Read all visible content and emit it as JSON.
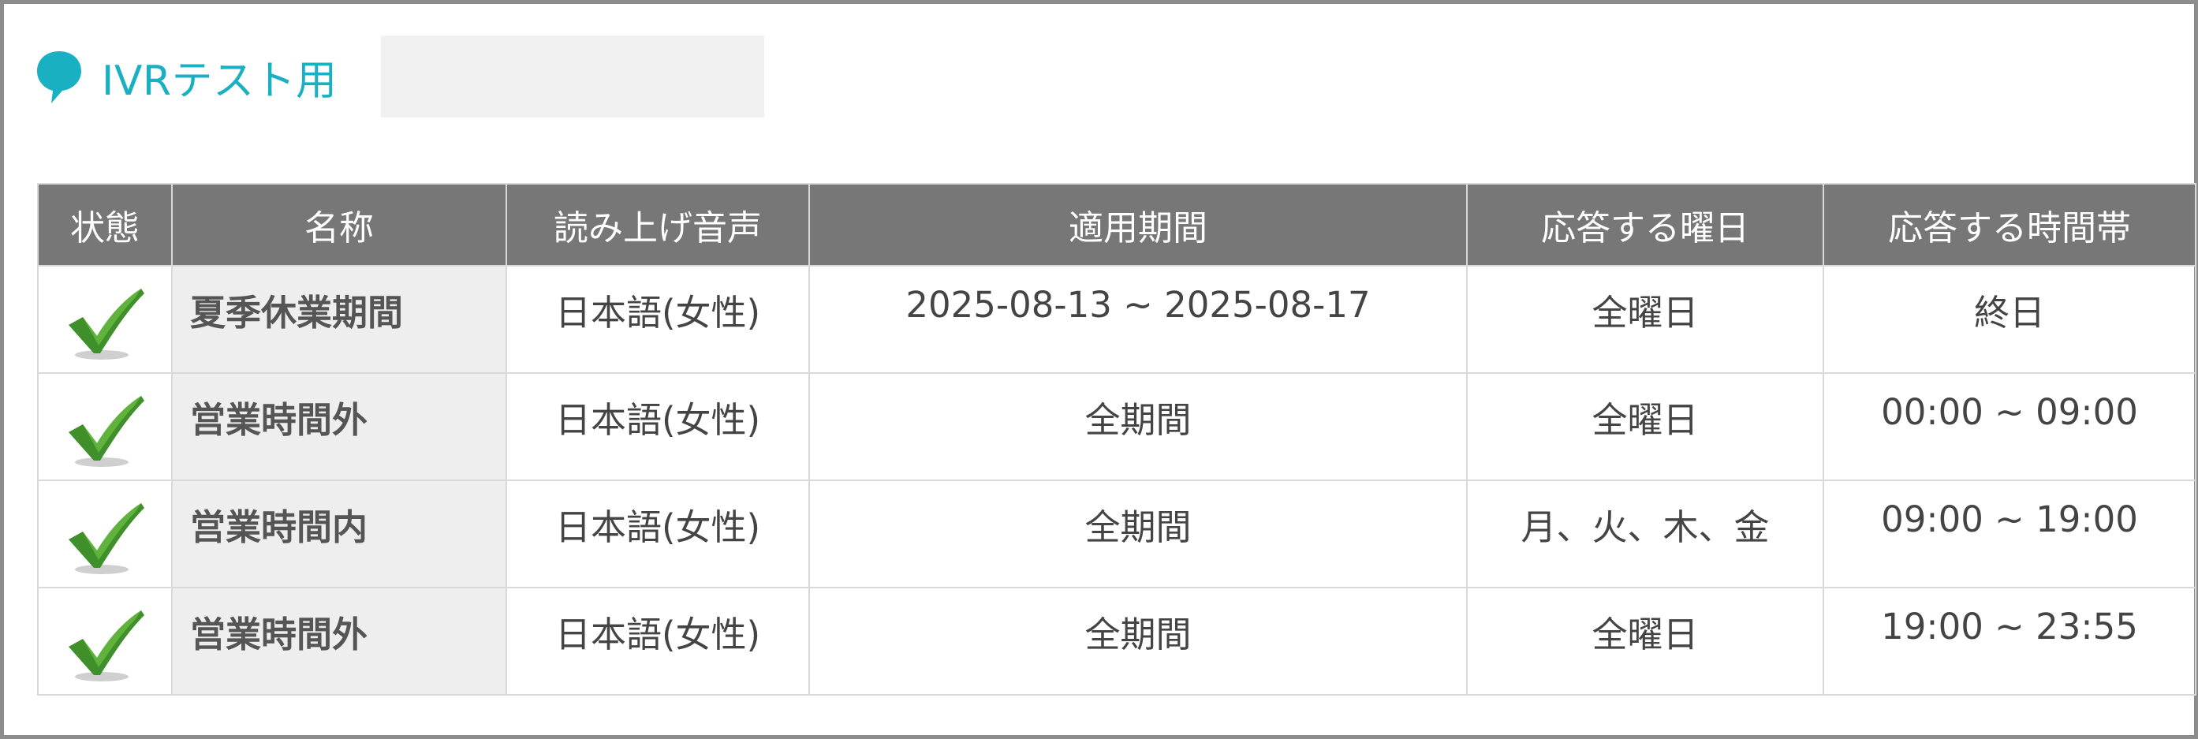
{
  "header": {
    "title": "IVRテスト用"
  },
  "table": {
    "columns": [
      "状態",
      "名称",
      "読み上げ音声",
      "適用期間",
      "応答する曜日",
      "応答する時間帯"
    ],
    "rows": [
      {
        "status": "check-icon",
        "name": "夏季休業期間",
        "voice": "日本語(女性)",
        "period": "2025-08-13 ~ 2025-08-17",
        "days": "全曜日",
        "hours": "終日"
      },
      {
        "status": "check-icon",
        "name": "営業時間外",
        "voice": "日本語(女性)",
        "period": "全期間",
        "days": "全曜日",
        "hours": "00:00 ~ 09:00"
      },
      {
        "status": "check-icon",
        "name": "営業時間内",
        "voice": "日本語(女性)",
        "period": "全期間",
        "days": "月、火、木、金",
        "hours": "09:00 ~ 19:00"
      },
      {
        "status": "check-icon",
        "name": "営業時間外",
        "voice": "日本語(女性)",
        "period": "全期間",
        "days": "全曜日",
        "hours": "19:00 ~ 23:55"
      }
    ]
  },
  "colors": {
    "accent": "#1ab0c4",
    "header_bg": "#777777",
    "check": "#3f8f2a"
  }
}
